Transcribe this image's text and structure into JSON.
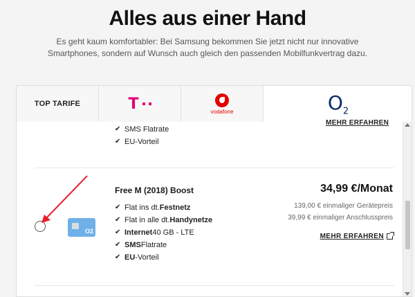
{
  "headline": "Alles aus einer Hand",
  "intro": "Es geht kaum komfortabler: Bei Samsung bekommen Sie jetzt nicht nur innovative Smartphones, sondern auf Wunsch auch gleich den passenden Mobilfunkvertrag dazu.",
  "tabs": {
    "top": "TOP TARIFE",
    "telekom": "T",
    "vodafone": "vodafone",
    "o2_main": "O",
    "o2_sub": "2"
  },
  "previous_plan": {
    "features": [
      {
        "text": "SMS Flatrate",
        "bold": "SMS"
      },
      {
        "text": "EU-Vorteil",
        "bold": "EU"
      }
    ],
    "more_label": "MEHR ERFAHREN"
  },
  "plan": {
    "name": "Free M (2018) Boost",
    "price": "34,99 €/Monat",
    "device_price": "139,00 € einmaliger Gerätepreis",
    "connection_price": "39,99 € einmaliger Anschlusspreis",
    "more_label": "MEHR ERFAHREN",
    "sim_brand": "O2",
    "features": [
      {
        "pre": "Flat ins dt. ",
        "bold": "Festnetz",
        "post": ""
      },
      {
        "pre": "Flat in alle dt. ",
        "bold": "Handynetze",
        "post": ""
      },
      {
        "pre": "",
        "bold": "Internet",
        "post": " 40 GB - LTE"
      },
      {
        "pre": "",
        "bold": "SMS",
        "post": " Flatrate"
      },
      {
        "pre": "",
        "bold": "EU",
        "post": "-Vorteil"
      }
    ]
  },
  "colors": {
    "telekom": "#e20074",
    "vodafone": "#e60000",
    "o2": "#0a2a6a",
    "arrow": "#e8202a"
  }
}
